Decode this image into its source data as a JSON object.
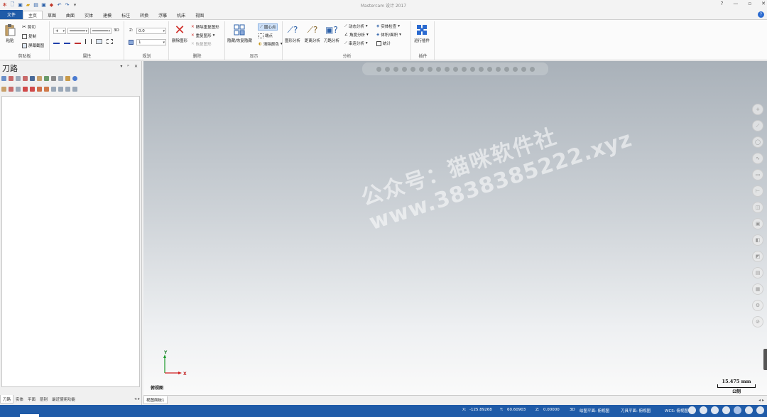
{
  "window": {
    "title": "Mastercam 设计 2017",
    "controls": [
      "?",
      "—",
      "▫",
      "✕"
    ]
  },
  "ribbon_tabs": [
    "文件",
    "主页",
    "草图",
    "曲面",
    "实体",
    "建模",
    "标注",
    "转换",
    "浮雕",
    "机床",
    "视图"
  ],
  "ribbon": {
    "clipboard": {
      "title": "剪贴板",
      "paste": "粘贴",
      "cut": "剪切",
      "copy": "复制",
      "screenshot": "屏幕截图"
    },
    "attributes": {
      "title": "属性",
      "mode_3d": "3D"
    },
    "plane": {
      "title": "规划",
      "z_label": "Z:",
      "z_value": "0.0",
      "level_value": "1"
    },
    "delete": {
      "title": "删除",
      "delete_entities": "删除图形",
      "delete_dup": "移除重复图形",
      "dup_entities": "重复图形",
      "undelete": "恢复图形"
    },
    "display": {
      "title": "显示",
      "hide_show": "隐藏/恢复隐藏",
      "center_point": "圆心点",
      "endpoints": "端点",
      "clear_color": "清除颜色"
    },
    "analyze": {
      "title": "分析",
      "entity_analysis": "图形分析",
      "distance": "距离分析",
      "toolpath": "刀路分析",
      "dynamic": "动态分析",
      "angle": "角度分析",
      "chain": "串连分析",
      "solid_check": "实体检查",
      "volume_area": "体积/面积",
      "statistics": "统计"
    },
    "addins": {
      "title": "插件",
      "run_addin": "运行插件"
    }
  },
  "left_panel": {
    "title": "刀路",
    "controls": [
      "▾",
      "ᵖ",
      "✕"
    ],
    "bottom_tabs": [
      "刀路",
      "实体",
      "平面",
      "层别",
      "最近使用功能"
    ]
  },
  "viewport": {
    "view_name": "俯视图",
    "axis_x": "X",
    "axis_y": "Y",
    "scale_value": "15.475 mm",
    "scale_unit": "公制",
    "watermark_line1": "公众号：猫咪软件社",
    "watermark_line2": "www.3838385222.xyz"
  },
  "sheet_tab": "视图面板1",
  "status": {
    "x_label": "X:",
    "x_value": "-125.89268",
    "y_label": "Y:",
    "y_value": "60.60903",
    "z_label": "Z:",
    "z_value": "0.00000",
    "mode": "3D",
    "drawing_plane": "绘图平面: 俯视图",
    "tool_plane": "刀具平面: 俯视图",
    "wcs": "WCS: 俯视图"
  },
  "colors": {
    "brand": "#1f5ba8",
    "delete_red": "#d0302a",
    "help_blue": "#2a6ad0"
  }
}
